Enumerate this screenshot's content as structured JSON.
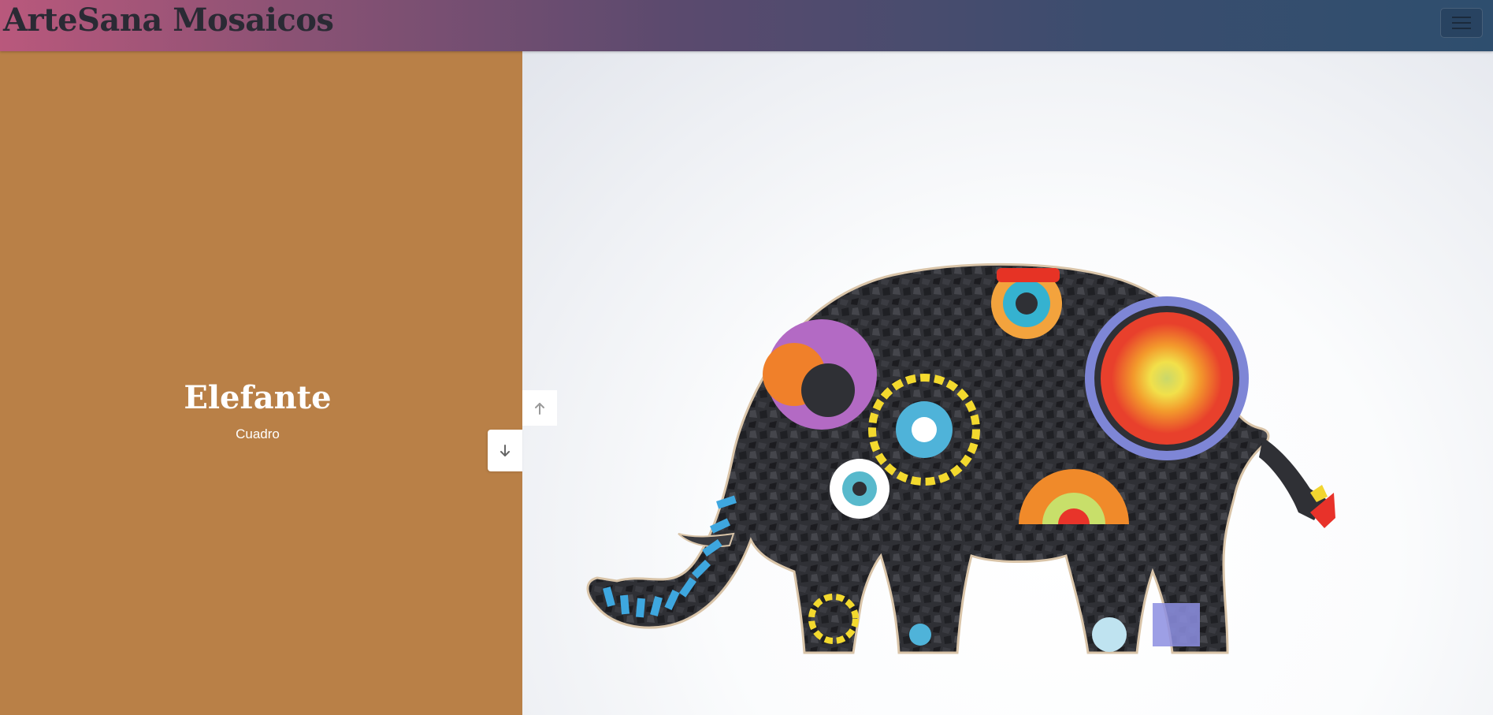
{
  "navbar": {
    "brand": "ArteSana Mosaicos",
    "toggler_icon": "hamburger-menu-icon"
  },
  "slide": {
    "title": "Elefante",
    "subtitle": "Cuadro",
    "background_color": "#b98047"
  },
  "controls": {
    "down_icon": "arrow-down-icon",
    "up_icon": "arrow-up-icon"
  },
  "photo": {
    "subject": "mosaic-elephant"
  }
}
